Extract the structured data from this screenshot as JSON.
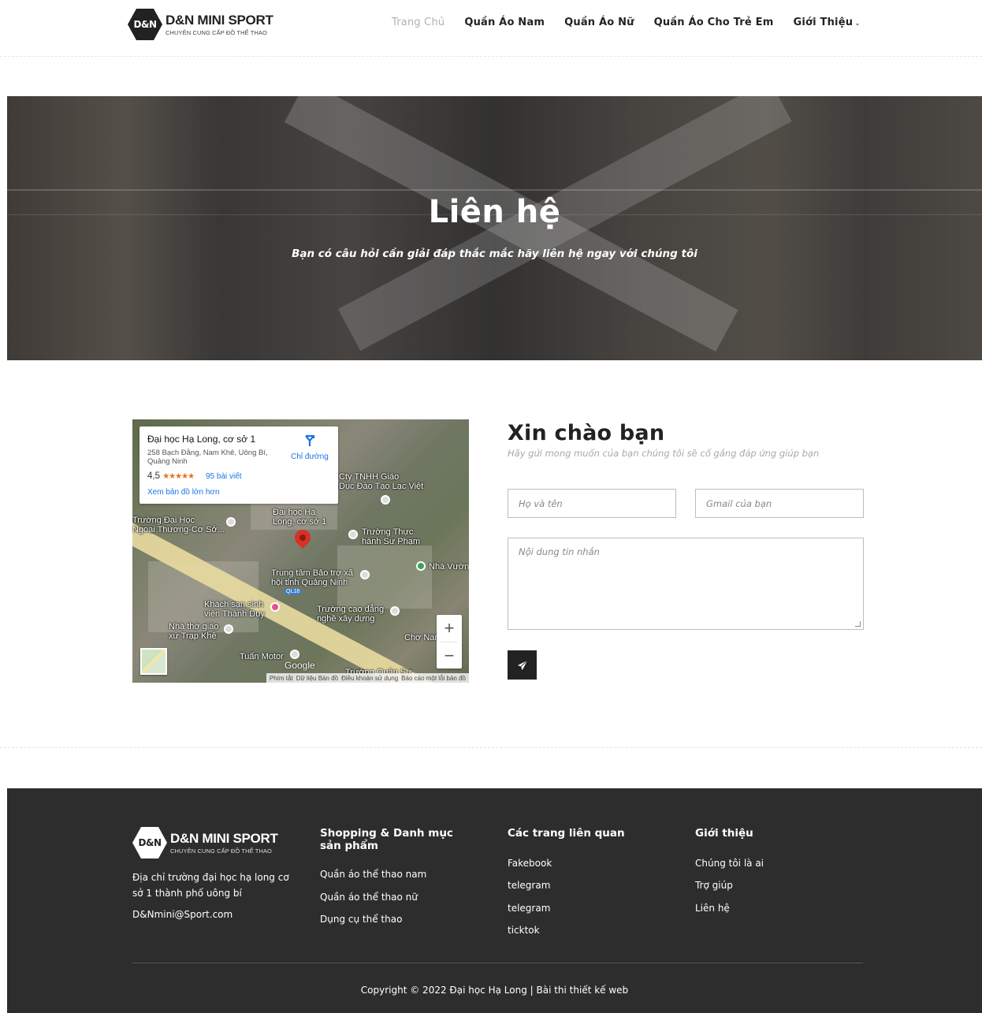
{
  "brand": {
    "short": "D&N",
    "name": "D&N MINI SPORT",
    "tagline": "CHUYÊN CUNG CẤP ĐỒ THỂ THAO"
  },
  "nav": {
    "items": [
      {
        "label": "Trang Chủ"
      },
      {
        "label": "Quần Áo Nam"
      },
      {
        "label": "Quần Áo Nữ"
      },
      {
        "label": "Quần Áo Cho Trẻ Em"
      },
      {
        "label": "Giới Thiệu"
      }
    ],
    "caret": "⌄"
  },
  "hero": {
    "title": "Liên hệ",
    "subtitle": "Bạn có câu hỏi cần giải đáp thắc mắc hãy liên hệ ngay với chúng tôi"
  },
  "map": {
    "card": {
      "title": "Đại học Hạ Long, cơ sở 1",
      "address": "258 Bạch Đằng, Nam Khê, Uông Bí, Quảng Ninh",
      "rating": "4,5",
      "stars": "★★★★★",
      "reviews": "95 bài viết",
      "larger_map": "Xem bản đồ lớn hơn",
      "directions": "Chỉ đường"
    },
    "labels": [
      "Cty TNHH Giáo\nDục Đào Tạo Lạc Việt",
      "Đại học Hạ\nLong, cơ sở 1",
      "Trường Đại Học\nNgoại Thương-Cơ Sở...",
      "Trường Thực\nhành Sư Phạm",
      "Nhà Vườn",
      "Trung tâm Bảo trợ xã\nhội tỉnh Quảng Ninh",
      "Khách sạn sinh\nviên Thành Duy",
      "Trường cao đẳng\nnghề xây dựng",
      "Nhà thờ giáo\nxứ Trạp Khê",
      "Chợ Nam",
      "Tuấn Motor",
      "Trường Quân Sự"
    ],
    "road_label": "QL18",
    "google": "Google",
    "footer": [
      "Phím tắt",
      "Dữ liệu Bản đồ",
      "Điều khoản sử dụng",
      "Báo cáo một lỗi bản đồ"
    ],
    "zoom_in": "+",
    "zoom_out": "−"
  },
  "contact": {
    "title": "Xin chào bạn",
    "subtitle": "Hãy gửi mong muốn của bạn chúng tôi sẽ cố gắng đáp ứng giúp bạn",
    "name_placeholder": "Họ và tên",
    "email_placeholder": "Gmail của bạn",
    "message_placeholder": "Nội dung tin nhắn",
    "send_icon": "paper-plane-icon"
  },
  "footer": {
    "address": "Địa chỉ trường đại học hạ long cơ sở 1 thành phố uông bí",
    "email": "D&Nmini@Sport.com",
    "columns": [
      {
        "heading": "Shopping & Danh mục sản phẩm",
        "links": [
          "Quần áo thể thao nam",
          "Quần áo thể thao nữ",
          "Dụng cụ thể thao"
        ]
      },
      {
        "heading": "Các trang liên quan",
        "links": [
          "Fakebook",
          "telegram",
          "telegram",
          "ticktok"
        ]
      },
      {
        "heading": "Giới thiệu",
        "links": [
          "Chúng tôi là ai",
          "Trợ giúp",
          "Liên hệ"
        ]
      }
    ],
    "copyright": "Copyright © 2022 Đại học Hạ Long | Bài thi thiết kế web"
  },
  "colors": {
    "dark": "#222222",
    "footer_bg": "#2d2d2d",
    "nav_active": "#b0b0b0",
    "map_link": "#1a73e8",
    "map_pin": "#d93025"
  }
}
